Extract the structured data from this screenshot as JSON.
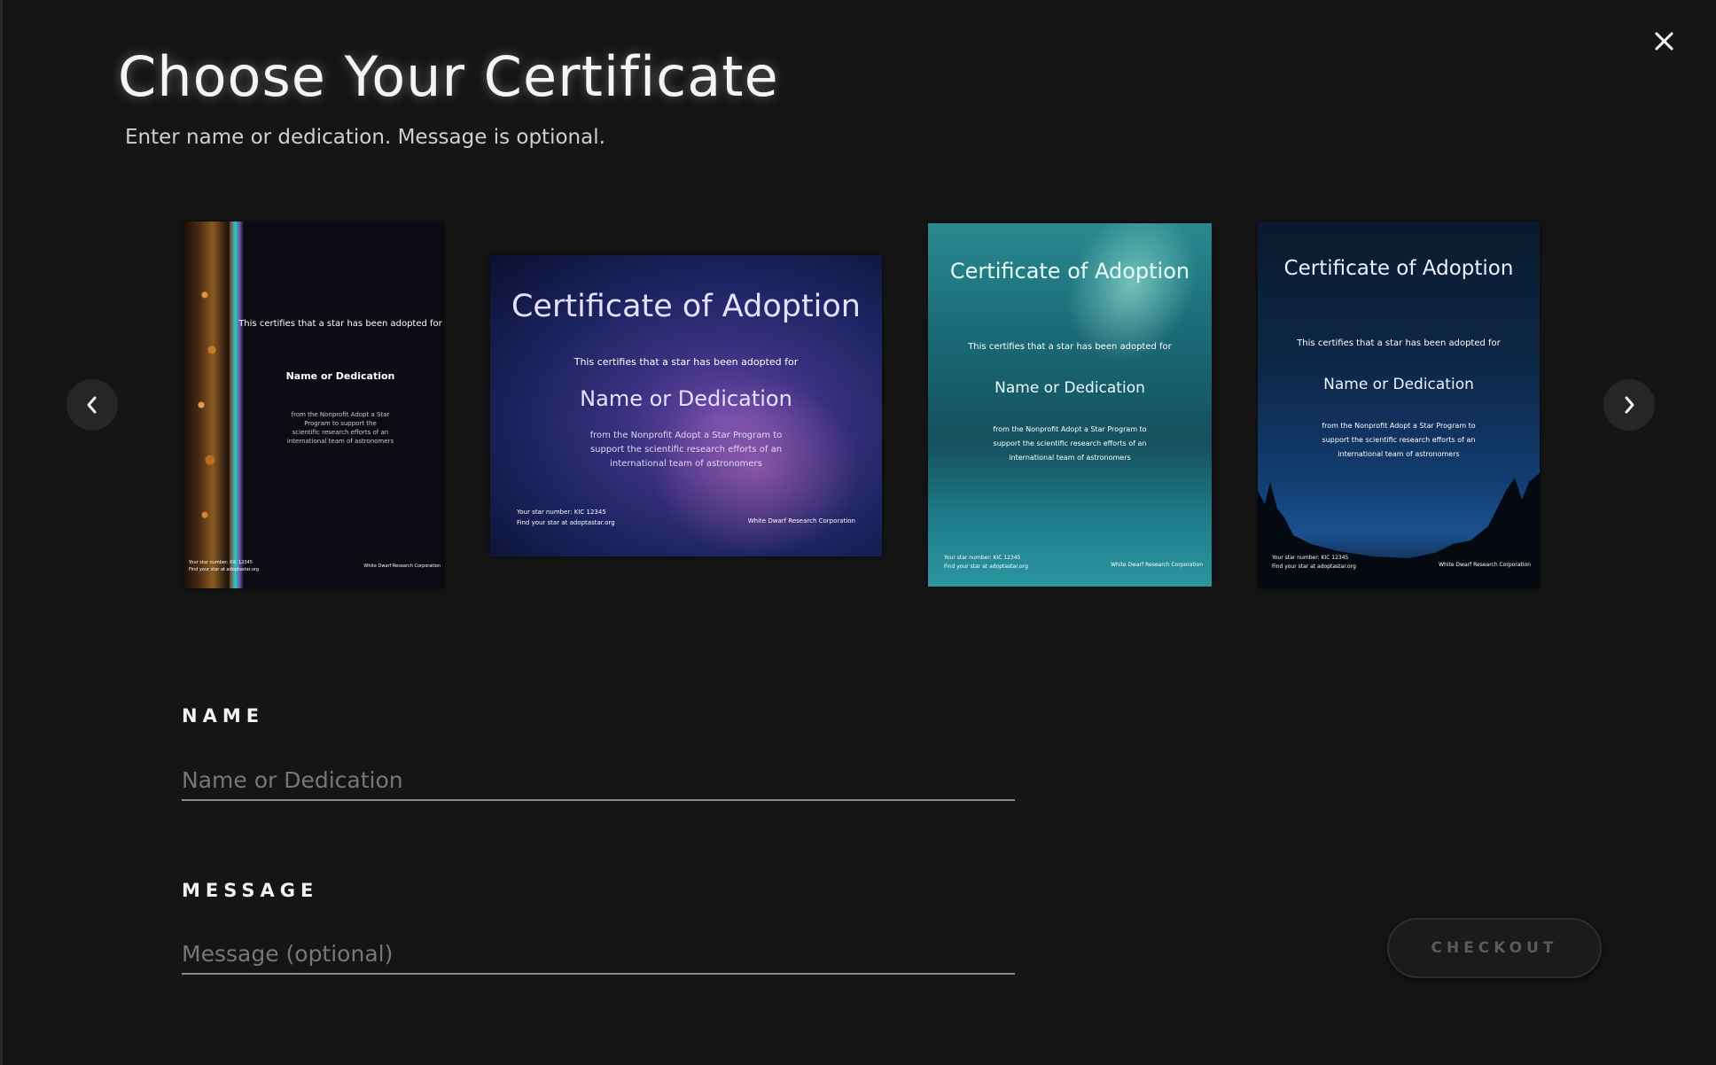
{
  "modal": {
    "title": "Choose Your Certificate",
    "subtitle": "Enter name or dedication. Message is optional.",
    "close_icon": "close-icon"
  },
  "carousel": {
    "prev_icon": "chevron-left-icon",
    "next_icon": "chevron-right-icon",
    "certificates": [
      {
        "theme": "earth-horizon",
        "heading": "",
        "line1": "This certifies that a star has been adopted for",
        "name": "Name or Dedication",
        "body": [
          "from the Nonprofit Adopt a Star",
          "Program to support the",
          "scientific research efforts of an",
          "international team of astronomers"
        ],
        "footer_left": "Your star number: KIC 12345",
        "footer_left2": "Find your star at adoptastar.org",
        "footer_right": "White Dwarf Research Corporation"
      },
      {
        "theme": "milky-way",
        "heading": "Certificate of Adoption",
        "line1": "This certifies that a star has been adopted for",
        "name": "Name or Dedication",
        "body": [
          "from the Nonprofit Adopt a Star Program to",
          "support the scientific research efforts of an",
          "international team of astronomers"
        ],
        "footer_left": "Your star number: KIC 12345",
        "footer_left2": "Find your star at adoptastar.org",
        "footer_right": "White Dwarf Research Corporation"
      },
      {
        "theme": "aurora",
        "heading": "Certificate of Adoption",
        "line1": "This certifies that a star has been adopted for",
        "name": "Name or Dedication",
        "body": [
          "from the Nonprofit Adopt a Star Program to",
          "support the scientific research efforts of an",
          "international team of astronomers"
        ],
        "footer_left": "Your star number: KIC 12345",
        "footer_left2": "Find your star at adoptastar.org",
        "footer_right": "White Dwarf Research Corporation"
      },
      {
        "theme": "forest-night",
        "heading": "Certificate of Adoption",
        "line1": "This certifies that a star has been adopted for",
        "name": "Name or Dedication",
        "body": [
          "from the Nonprofit Adopt a Star Program to",
          "support the scientific research efforts of an",
          "international team of astronomers"
        ],
        "footer_left": "Your star number: KIC 12345",
        "footer_left2": "Find your star at adoptastar.org",
        "footer_right": "White Dwarf Research Corporation"
      }
    ]
  },
  "form": {
    "name_label": "NAME",
    "name_placeholder": "Name or Dedication",
    "name_value": "",
    "message_label": "MESSAGE",
    "message_placeholder": "Message (optional)",
    "message_value": "",
    "checkout_label": "CHECKOUT",
    "checkout_enabled": false
  },
  "colors": {
    "background": "#151515",
    "text": "#f2f2f2",
    "muted": "#777777",
    "button_disabled_text": "#5a5a5a"
  }
}
